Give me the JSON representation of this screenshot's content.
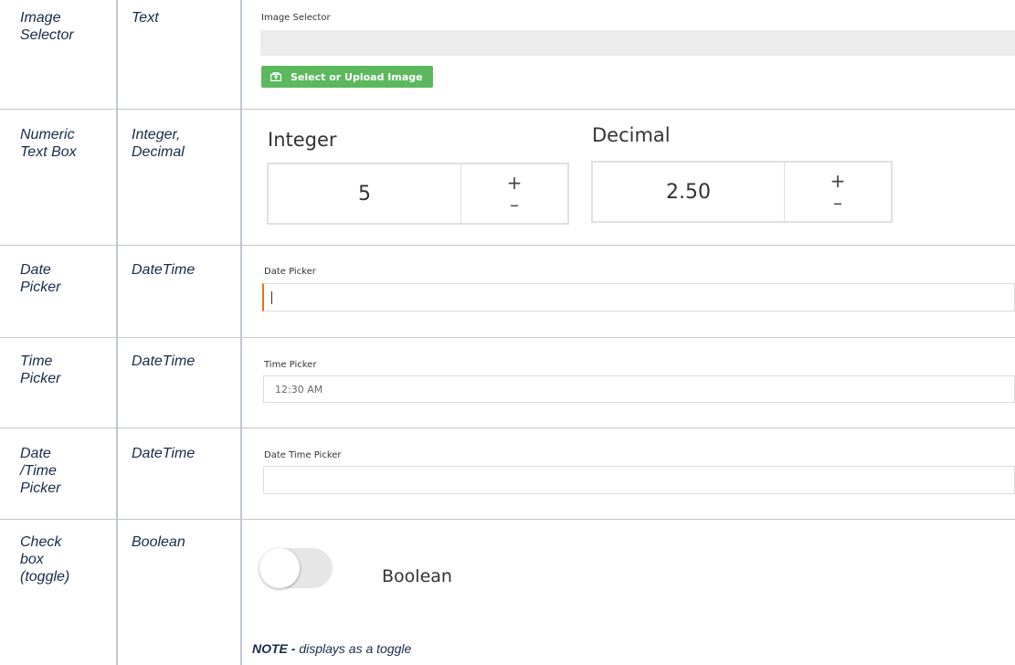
{
  "rows": [
    {
      "control": "Image\nSelector",
      "type": "Text",
      "preview": {
        "field_label": "Image Selector",
        "button_label": "Select or Upload Image",
        "button_icon": "image-upload-icon"
      }
    },
    {
      "control": "Numeric\nText Box",
      "type": "Integer,\nDecimal",
      "preview": {
        "integer_label": "Integer",
        "integer_value": "5",
        "decimal_label": "Decimal",
        "decimal_value": "2.50",
        "plus": "+",
        "minus": "–"
      }
    },
    {
      "control": "Date\nPicker",
      "type": "DateTime",
      "preview": {
        "field_label": "Date Picker",
        "value": ""
      }
    },
    {
      "control": "Time\nPicker",
      "type": "DateTime",
      "preview": {
        "field_label": "Time Picker",
        "value": "12:30 AM"
      }
    },
    {
      "control": "Date\n/Time\nPicker",
      "type": "DateTime",
      "preview": {
        "field_label": "Date Time Picker",
        "value": ""
      }
    },
    {
      "control": "Check\nbox\n(toggle)",
      "type": "Boolean",
      "preview": {
        "toggle_label": "Boolean",
        "toggle_on": false,
        "note_bold": "NOTE -",
        "note_text": " displays as a toggle"
      }
    }
  ],
  "colors": {
    "grid": "#c1c7d0",
    "button_green": "#5cb85c",
    "focus_orange": "#e8701a",
    "field_gray": "#ececec"
  }
}
